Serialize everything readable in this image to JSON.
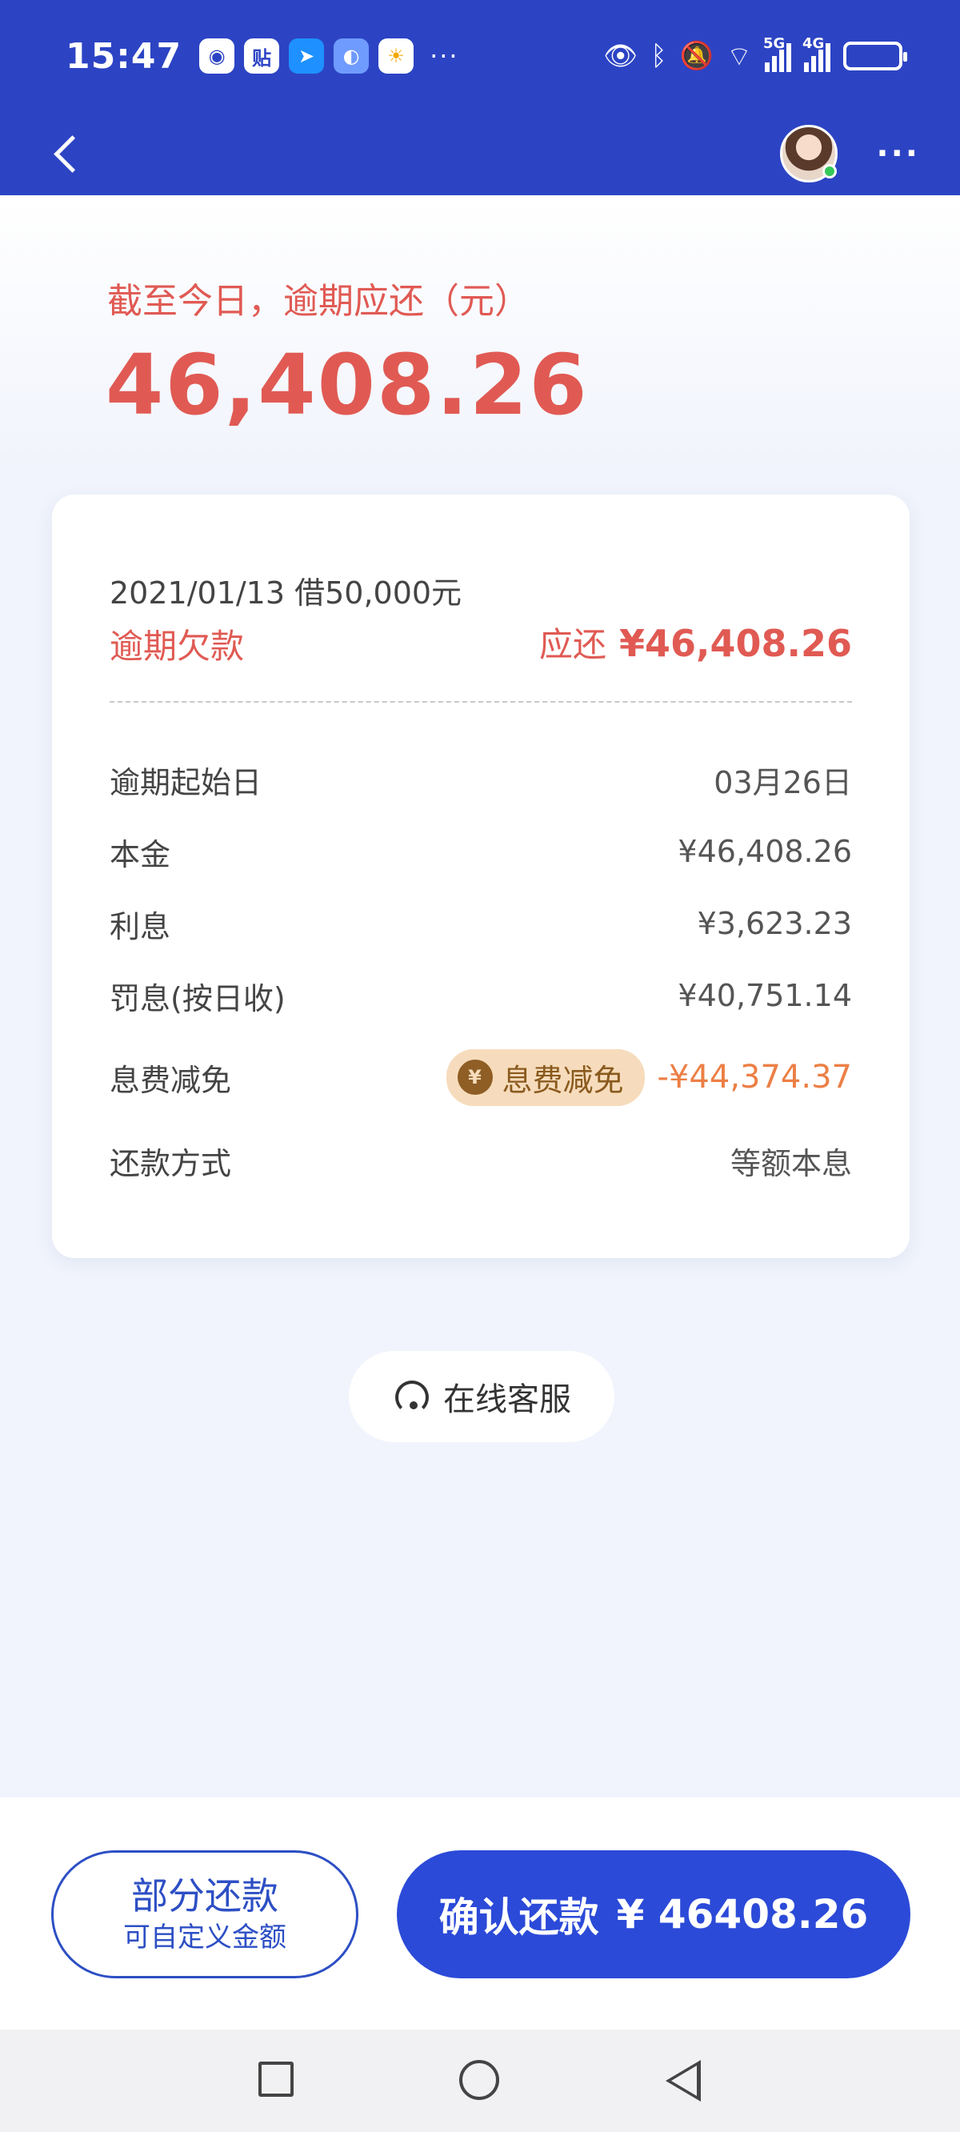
{
  "status_bar": {
    "time": "15:47",
    "app_icons": [
      "app-icon-1",
      "tieba-icon",
      "feishu-icon",
      "browser-icon",
      "weather-icon"
    ],
    "app_icon_2_text": "贴",
    "more": "···",
    "network": [
      "5G",
      "4G"
    ]
  },
  "header": {
    "back_icon": "chevron-left-icon",
    "menu": "···"
  },
  "summary": {
    "label": "截至今日，逾期应还（元）",
    "amount": "46,408.26"
  },
  "loan": {
    "date_line": "2021/01/13  借50,000元",
    "status_label": "逾期欠款",
    "due_label": "应还",
    "due_amount": "¥46,408.26"
  },
  "details": [
    {
      "label": "逾期起始日",
      "value": "03月26日"
    },
    {
      "label": "本金",
      "value": "¥46,408.26"
    },
    {
      "label": "利息",
      "value": "¥3,623.23"
    },
    {
      "label": "罚息(按日收)",
      "value": "¥40,751.14"
    }
  ],
  "discount": {
    "label": "息费减免",
    "badge": "息费减免",
    "badge_icon_text": "¥",
    "value": "-¥44,374.37"
  },
  "repay_method": {
    "label": "还款方式",
    "value": "等额本息"
  },
  "customer_service": {
    "label": "在线客服"
  },
  "actions": {
    "partial_title": "部分还款",
    "partial_sub": "可自定义金额",
    "confirm_label": "确认还款",
    "confirm_amount": "¥ 46408.26"
  },
  "colors": {
    "header_bg": "#2c44c4",
    "accent_red": "#e05a53",
    "primary_blue": "#2b4ad8",
    "discount_orange": "#ec7f45"
  }
}
